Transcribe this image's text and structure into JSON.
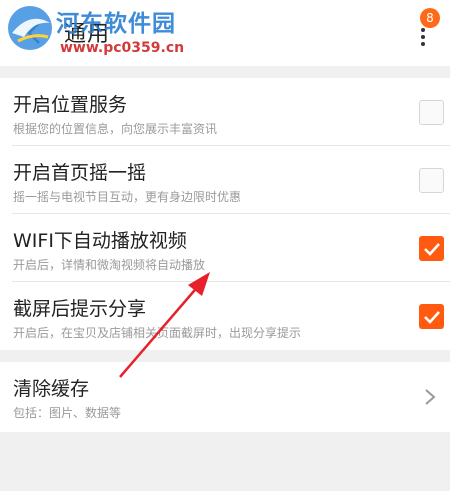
{
  "header": {
    "title": "通用",
    "badge_count": "8"
  },
  "watermark": {
    "site_name": "河东软件园",
    "url": "www.pc0359.cn"
  },
  "settings": {
    "items": [
      {
        "title": "开启位置服务",
        "subtitle": "根据您的位置信息，向您展示丰富资讯",
        "checked": false
      },
      {
        "title": "开启首页摇一摇",
        "subtitle": "摇一摇与电视节目互动，更有身边限时优惠",
        "checked": false
      },
      {
        "title": "WIFI下自动播放视频",
        "subtitle": "开启后，详情和微淘视频将自动播放",
        "checked": true
      },
      {
        "title": "截屏后提示分享",
        "subtitle": "开启后，在宝贝及店铺相关页面截屏时，出现分享提示",
        "checked": true
      }
    ]
  },
  "cache": {
    "title": "清除缓存",
    "subtitle": "包括：图片、数据等"
  },
  "colors": {
    "accent": "#ff5a0f",
    "annotation_arrow": "#e8202a",
    "watermark_blue": "#2a7fd4",
    "watermark_red": "#d23b3b"
  },
  "icons": {
    "back": "chevron-left-icon",
    "more": "more-vertical-icon",
    "check": "check-icon",
    "chevron": "chevron-right-icon"
  }
}
